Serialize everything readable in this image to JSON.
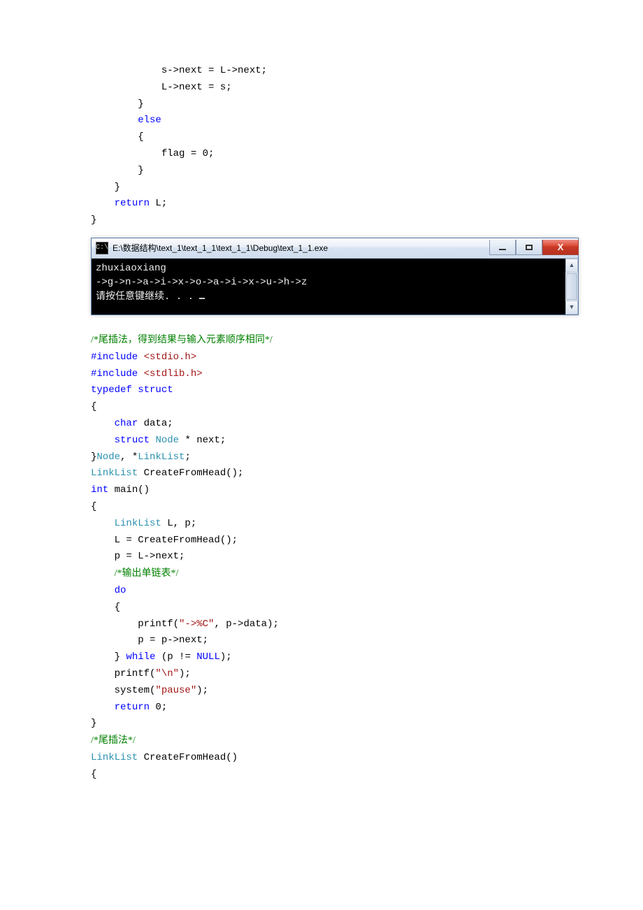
{
  "code_top": {
    "l1": "            s->next = L->next;",
    "l2": "            L->next = s;",
    "l3": "        }",
    "l4_else": "else",
    "l5": "        {",
    "l6": "            flag = 0;",
    "l7": "        }",
    "l8": "    }",
    "l9_return": "return",
    "l9_rest": " L;",
    "l10": "}"
  },
  "console": {
    "icon_label": "C:\\",
    "title": "E:\\数据结构\\text_1\\text_1_1\\text_1_1\\Debug\\text_1_1.exe",
    "line1": "zhuxiaoxiang",
    "line2": "->g->n->a->i->x->o->a->i->x->u->h->z",
    "line3": "请按任意键继续. . . ",
    "btn_min": "min",
    "btn_max": "max",
    "btn_close": "X",
    "scroll_up": "▲",
    "scroll_down": "▼"
  },
  "code_bottom": {
    "cmt1": "/*尾插法，得到结果与输入元素顺序相同*/",
    "inc1_a": "#include",
    "inc1_b": " <stdio.h>",
    "inc2_a": "#include",
    "inc2_b": " <stdlib.h>",
    "typedef_a": "typedef",
    "typedef_b": "struct",
    "lb1": "{",
    "char_kw": "char",
    "char_rest": " data;",
    "struct_kw": "struct",
    "node_type": "Node",
    "struct_rest": " * next;",
    "rb_node_a": "}",
    "rb_node_b": "Node",
    "rb_node_c": ", *",
    "rb_node_d": "LinkList",
    "rb_node_e": ";",
    "decl_a": "LinkList",
    "decl_b": " CreateFromHead();",
    "int_kw": "int",
    "main_rest": " main()",
    "lb2": "{",
    "main_l1_a": "LinkList",
    "main_l1_b": " L, p;",
    "main_l2": "    L = CreateFromHead();",
    "main_l3": "    p = L->next;",
    "cmt2": "/*输出单链表*/",
    "do_kw": "do",
    "lb3": "    {",
    "printf1_a": "        printf(",
    "printf1_str": "\"->%C\"",
    "printf1_b": ", p->data);",
    "pnext": "        p = p->next;",
    "rb_while_a": "    } ",
    "while_kw": "while",
    "rb_while_b": " (p != ",
    "null_kw": "NULL",
    "rb_while_c": ");",
    "printf2_a": "    printf(",
    "printf2_str": "\"\\n\"",
    "printf2_b": ");",
    "system_a": "    system(",
    "system_str": "\"pause\"",
    "system_b": ");",
    "return_kw": "return",
    "return_rest": " 0;",
    "rb2": "}",
    "cmt3": "/*尾插法*/",
    "def_a": "LinkList",
    "def_b": " CreateFromHead()",
    "lb4": "{"
  }
}
